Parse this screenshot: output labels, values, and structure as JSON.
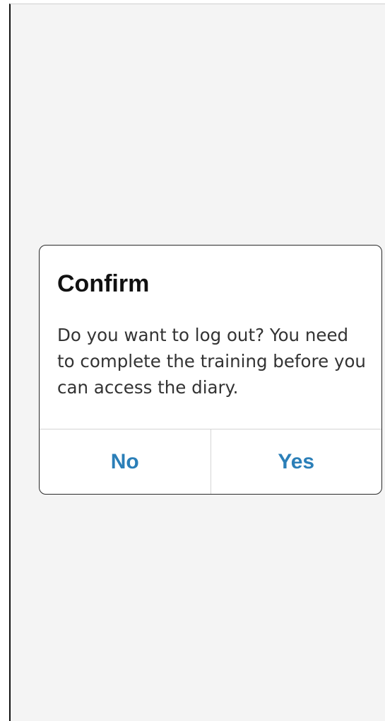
{
  "dialog": {
    "title": "Confirm",
    "message": "Do you want to log out? You need to complete the training before you can access the diary.",
    "buttons": {
      "no_label": "No",
      "yes_label": "Yes"
    }
  },
  "colors": {
    "background": "#f4f4f4",
    "dialog_background": "#ffffff",
    "button_text": "#2b7fb8",
    "title_text": "#111111",
    "message_text": "#333333"
  }
}
